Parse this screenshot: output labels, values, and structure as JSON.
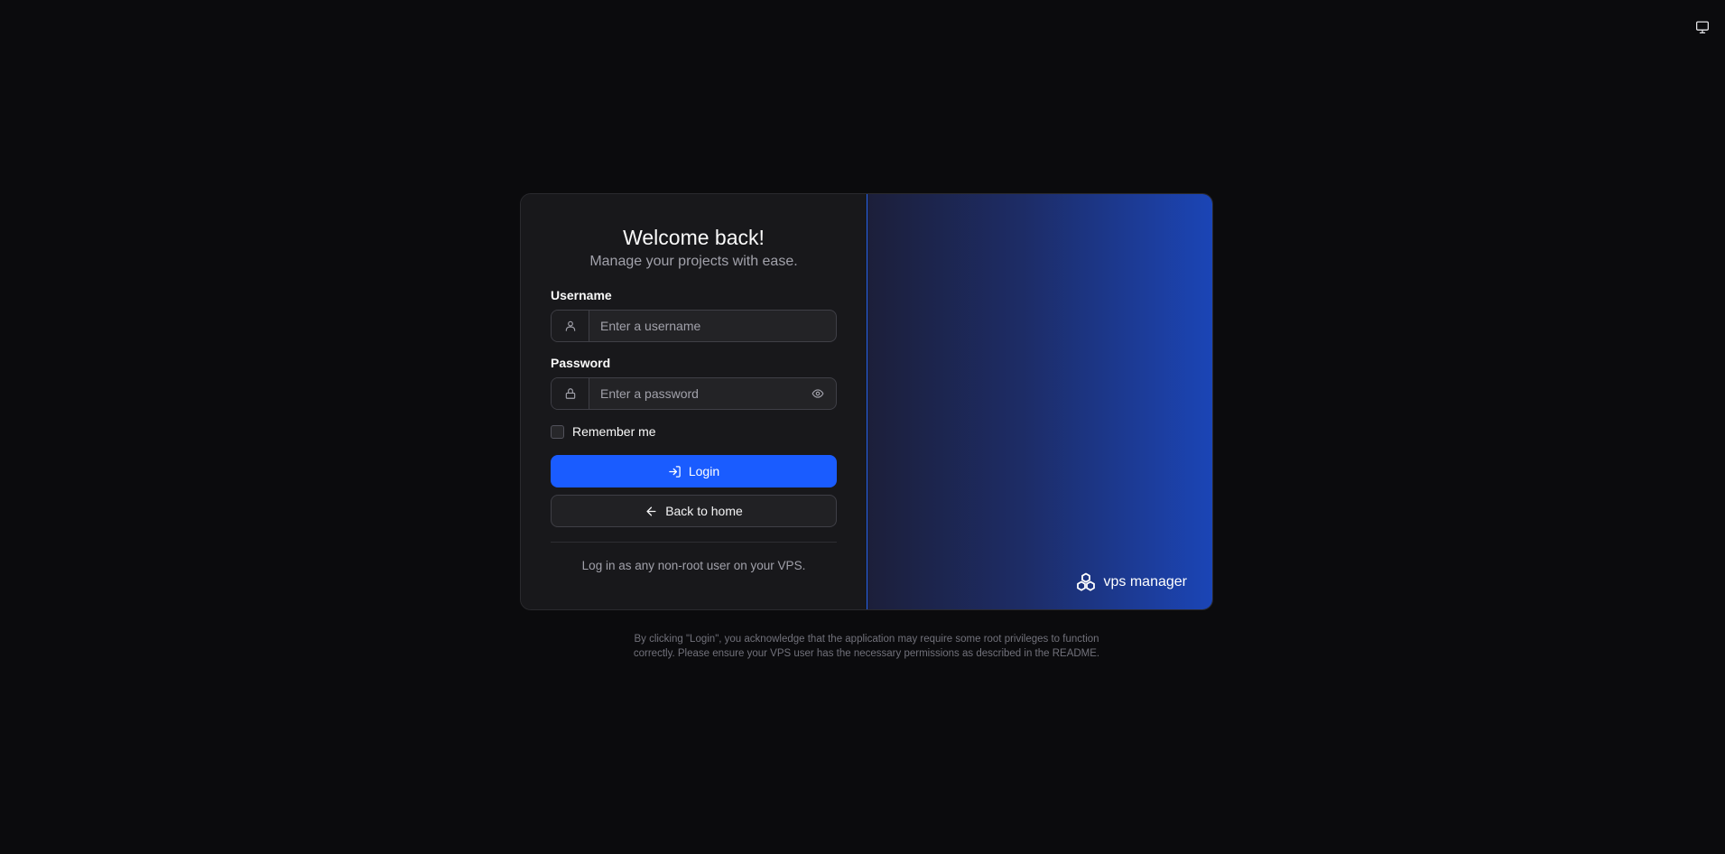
{
  "top_right": {
    "icon": "monitor-icon"
  },
  "login": {
    "title": "Welcome back!",
    "subtitle": "Manage your projects with ease.",
    "username": {
      "label": "Username",
      "placeholder": "Enter a username",
      "value": "",
      "icon": "user-icon"
    },
    "password": {
      "label": "Password",
      "placeholder": "Enter a password",
      "value": "",
      "icon": "lock-icon",
      "toggle_icon": "eye-icon"
    },
    "remember": {
      "label": "Remember me",
      "checked": false
    },
    "login_button": {
      "label": "Login",
      "icon": "log-in-icon"
    },
    "back_button": {
      "label": "Back to home",
      "icon": "arrow-left-icon"
    },
    "note": "Log in as any non-root user on your VPS."
  },
  "brand": {
    "name": "vps manager",
    "icon": "boxes-icon"
  },
  "disclaimer": {
    "line1": "By clicking \"Login\", you acknowledge that the application may require some root privileges to function",
    "line2": "correctly. Please ensure your VPS user has the necessary permissions as described in the README."
  },
  "colors": {
    "background": "#0b0b0d",
    "card": "#18181b",
    "primary": "#1a5cff",
    "gradient_start": "#1c1f3a",
    "gradient_end": "#1b45b6"
  }
}
